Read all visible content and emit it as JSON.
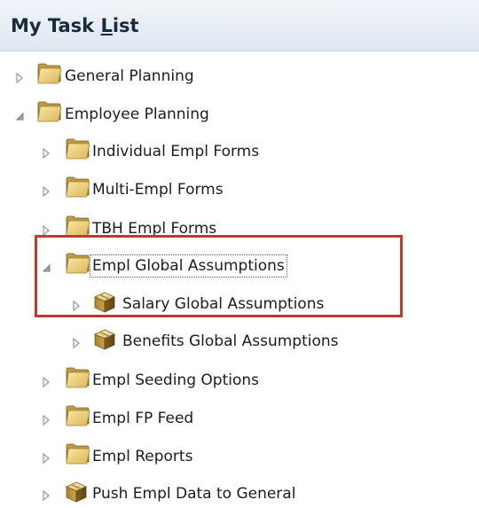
{
  "panel": {
    "title_prefix": "My Task ",
    "title_mnemonic": "L",
    "title_suffix": "ist"
  },
  "tree": [
    {
      "label": "General Planning",
      "icon": "folder-icon",
      "toggle": "expand"
    },
    {
      "label": "Employee Planning",
      "icon": "folder-icon",
      "toggle": "collapse"
    },
    {
      "label": "Individual Empl Forms",
      "icon": "folder-icon",
      "toggle": "expand"
    },
    {
      "label": "Multi-Empl Forms",
      "icon": "folder-icon",
      "toggle": "expand"
    },
    {
      "label": "TBH Empl Forms",
      "icon": "folder-icon",
      "toggle": "expand"
    },
    {
      "label": "Empl Global Assumptions",
      "icon": "folder-icon",
      "toggle": "collapse",
      "selected": true
    },
    {
      "label": "Salary Global Assumptions",
      "icon": "cube-icon",
      "toggle": "expand"
    },
    {
      "label": "Benefits Global Assumptions",
      "icon": "cube-icon",
      "toggle": "expand"
    },
    {
      "label": "Empl Seeding Options",
      "icon": "folder-icon",
      "toggle": "expand"
    },
    {
      "label": "Empl FP Feed",
      "icon": "folder-icon",
      "toggle": "expand"
    },
    {
      "label": "Empl Reports",
      "icon": "folder-icon",
      "toggle": "expand"
    },
    {
      "label": "Push Empl Data to General",
      "icon": "cube-icon",
      "toggle": "expand"
    }
  ],
  "colors": {
    "highlight_box": "#c0392b",
    "header_text": "#1a2a3e"
  }
}
